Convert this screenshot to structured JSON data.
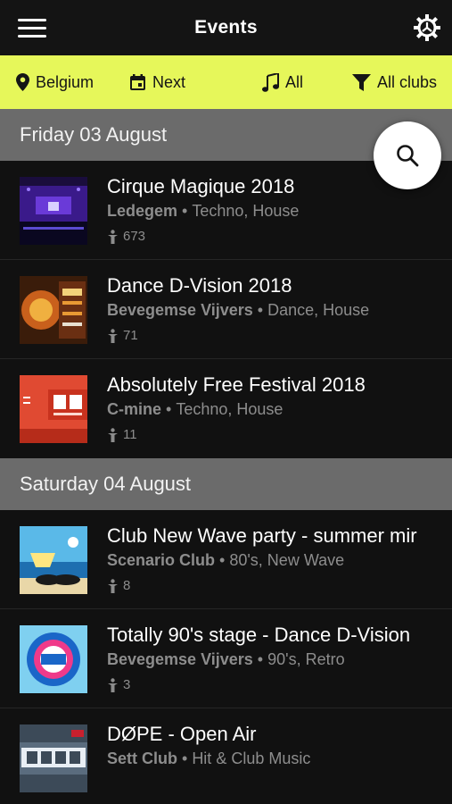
{
  "header": {
    "title": "Events"
  },
  "filters": {
    "country": "Belgium",
    "time": "Next",
    "genre": "All",
    "clubs": "All clubs"
  },
  "colors": {
    "accent": "#e6f75a",
    "background": "#111111",
    "day_header": "#6b6b6b"
  },
  "days": [
    {
      "label": "Friday 03 August",
      "events": [
        {
          "title": "Cirque Magique 2018",
          "club": "Ledegem",
          "genres": "Techno, House",
          "attendees": "673",
          "thumb": "thumb-purple-stage"
        },
        {
          "title": "Dance D-Vision 2018",
          "club": "Bevegemse Vijvers",
          "genres": "Dance, House",
          "attendees": "71",
          "thumb": "thumb-orange-poster"
        },
        {
          "title": "Absolutely Free Festival 2018",
          "club": "C-mine",
          "genres": "Techno, House",
          "attendees": "11",
          "thumb": "thumb-red-poster"
        }
      ]
    },
    {
      "label": "Saturday 04 August",
      "events": [
        {
          "title": "Club New Wave party - summer mir",
          "club": "Scenario Club",
          "genres": "80's, New Wave",
          "attendees": "8",
          "thumb": "thumb-beach"
        },
        {
          "title": "Totally 90's stage - Dance D-Vision",
          "club": "Bevegemse Vijvers",
          "genres": "90's, Retro",
          "attendees": "3",
          "thumb": "thumb-totally-90s"
        },
        {
          "title": "DØPE - Open Air",
          "club": "Sett Club",
          "genres": "Hit & Club Music",
          "attendees": "",
          "thumb": "thumb-dope"
        }
      ]
    }
  ],
  "sep": "•"
}
